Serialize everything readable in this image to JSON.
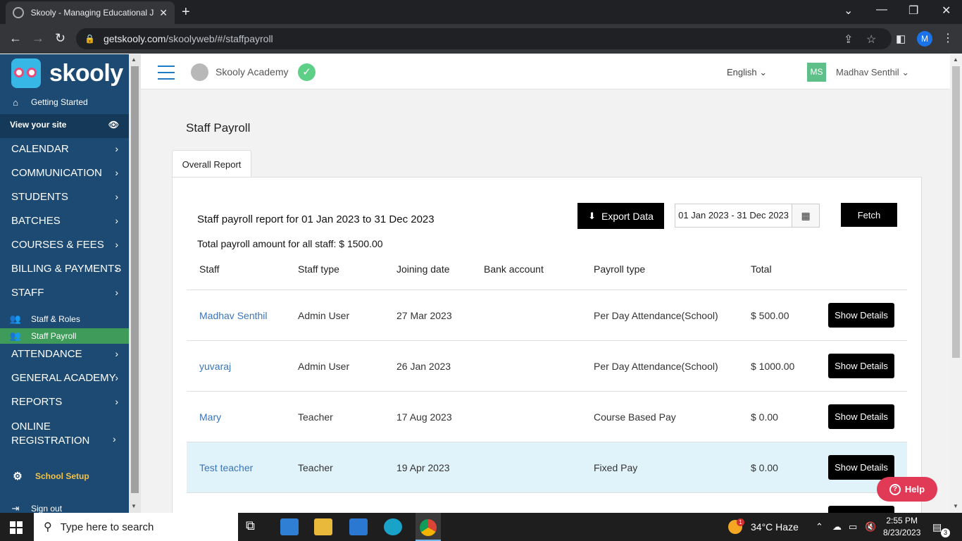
{
  "browser": {
    "tab_title": "Skooly - Managing Educational Ju",
    "url_domain": "getskooly.com",
    "url_path": "/skoolyweb/#/staffpayroll",
    "profile_initial": "M"
  },
  "sidebar": {
    "logo_text": "skooly",
    "getting_started": "Getting Started",
    "view_site": "View your site",
    "items": [
      {
        "label": "CALENDAR"
      },
      {
        "label": "COMMUNICATION"
      },
      {
        "label": "STUDENTS"
      },
      {
        "label": "BATCHES"
      },
      {
        "label": "COURSES & FEES"
      },
      {
        "label": "BILLING & PAYMENTS"
      },
      {
        "label": "STAFF"
      }
    ],
    "staff_sub": [
      {
        "label": "Staff & Roles"
      },
      {
        "label": "Staff Payroll"
      }
    ],
    "items2": [
      {
        "label": "ATTENDANCE"
      },
      {
        "label": "GENERAL ACADEMY"
      },
      {
        "label": "REPORTS"
      },
      {
        "label": "ONLINE REGISTRATION"
      }
    ],
    "school_setup": "School Setup",
    "sign_out": "Sign out"
  },
  "topbar": {
    "academy_name": "Skooly Academy",
    "language": "English",
    "user_initials": "MS",
    "user_name": "Madhav Senthil"
  },
  "page": {
    "title": "Staff Payroll",
    "tab": "Overall Report",
    "summary_range": "Staff payroll report for 01 Jan 2023 to 31 Dec 2023",
    "summary_total": "Total payroll amount for all staff: $ 1500.00",
    "export_label": "Export Data",
    "date_range": "01 Jan 2023 - 31 Dec 2023",
    "fetch_label": "Fetch"
  },
  "table": {
    "columns": [
      "Staff",
      "Staff type",
      "Joining date",
      "Bank account",
      "Payroll type",
      "Total"
    ],
    "rows": [
      {
        "staff": "Madhav Senthil",
        "type": "Admin User",
        "joining": "27 Mar 2023",
        "bank": "",
        "payroll": "Per Day Attendance(School)",
        "total": "$ 500.00",
        "action": "Show Details"
      },
      {
        "staff": "yuvaraj",
        "type": "Admin User",
        "joining": "26 Jan 2023",
        "bank": "",
        "payroll": "Per Day Attendance(School)",
        "total": "$ 1000.00",
        "action": "Show Details"
      },
      {
        "staff": "Mary",
        "type": "Teacher",
        "joining": "17 Aug 2023",
        "bank": "",
        "payroll": "Course Based Pay",
        "total": "$ 0.00",
        "action": "Show Details"
      },
      {
        "staff": "Test teacher",
        "type": "Teacher",
        "joining": "19 Apr 2023",
        "bank": "",
        "payroll": "Fixed Pay",
        "total": "$ 0.00",
        "action": "Show Details"
      }
    ]
  },
  "help_label": "Help",
  "taskbar": {
    "search_placeholder": "Type here to search",
    "weather": "34°C  Haze",
    "time": "2:55 PM",
    "date": "8/23/2023",
    "notification_count": "3",
    "weather_badge": "1"
  }
}
